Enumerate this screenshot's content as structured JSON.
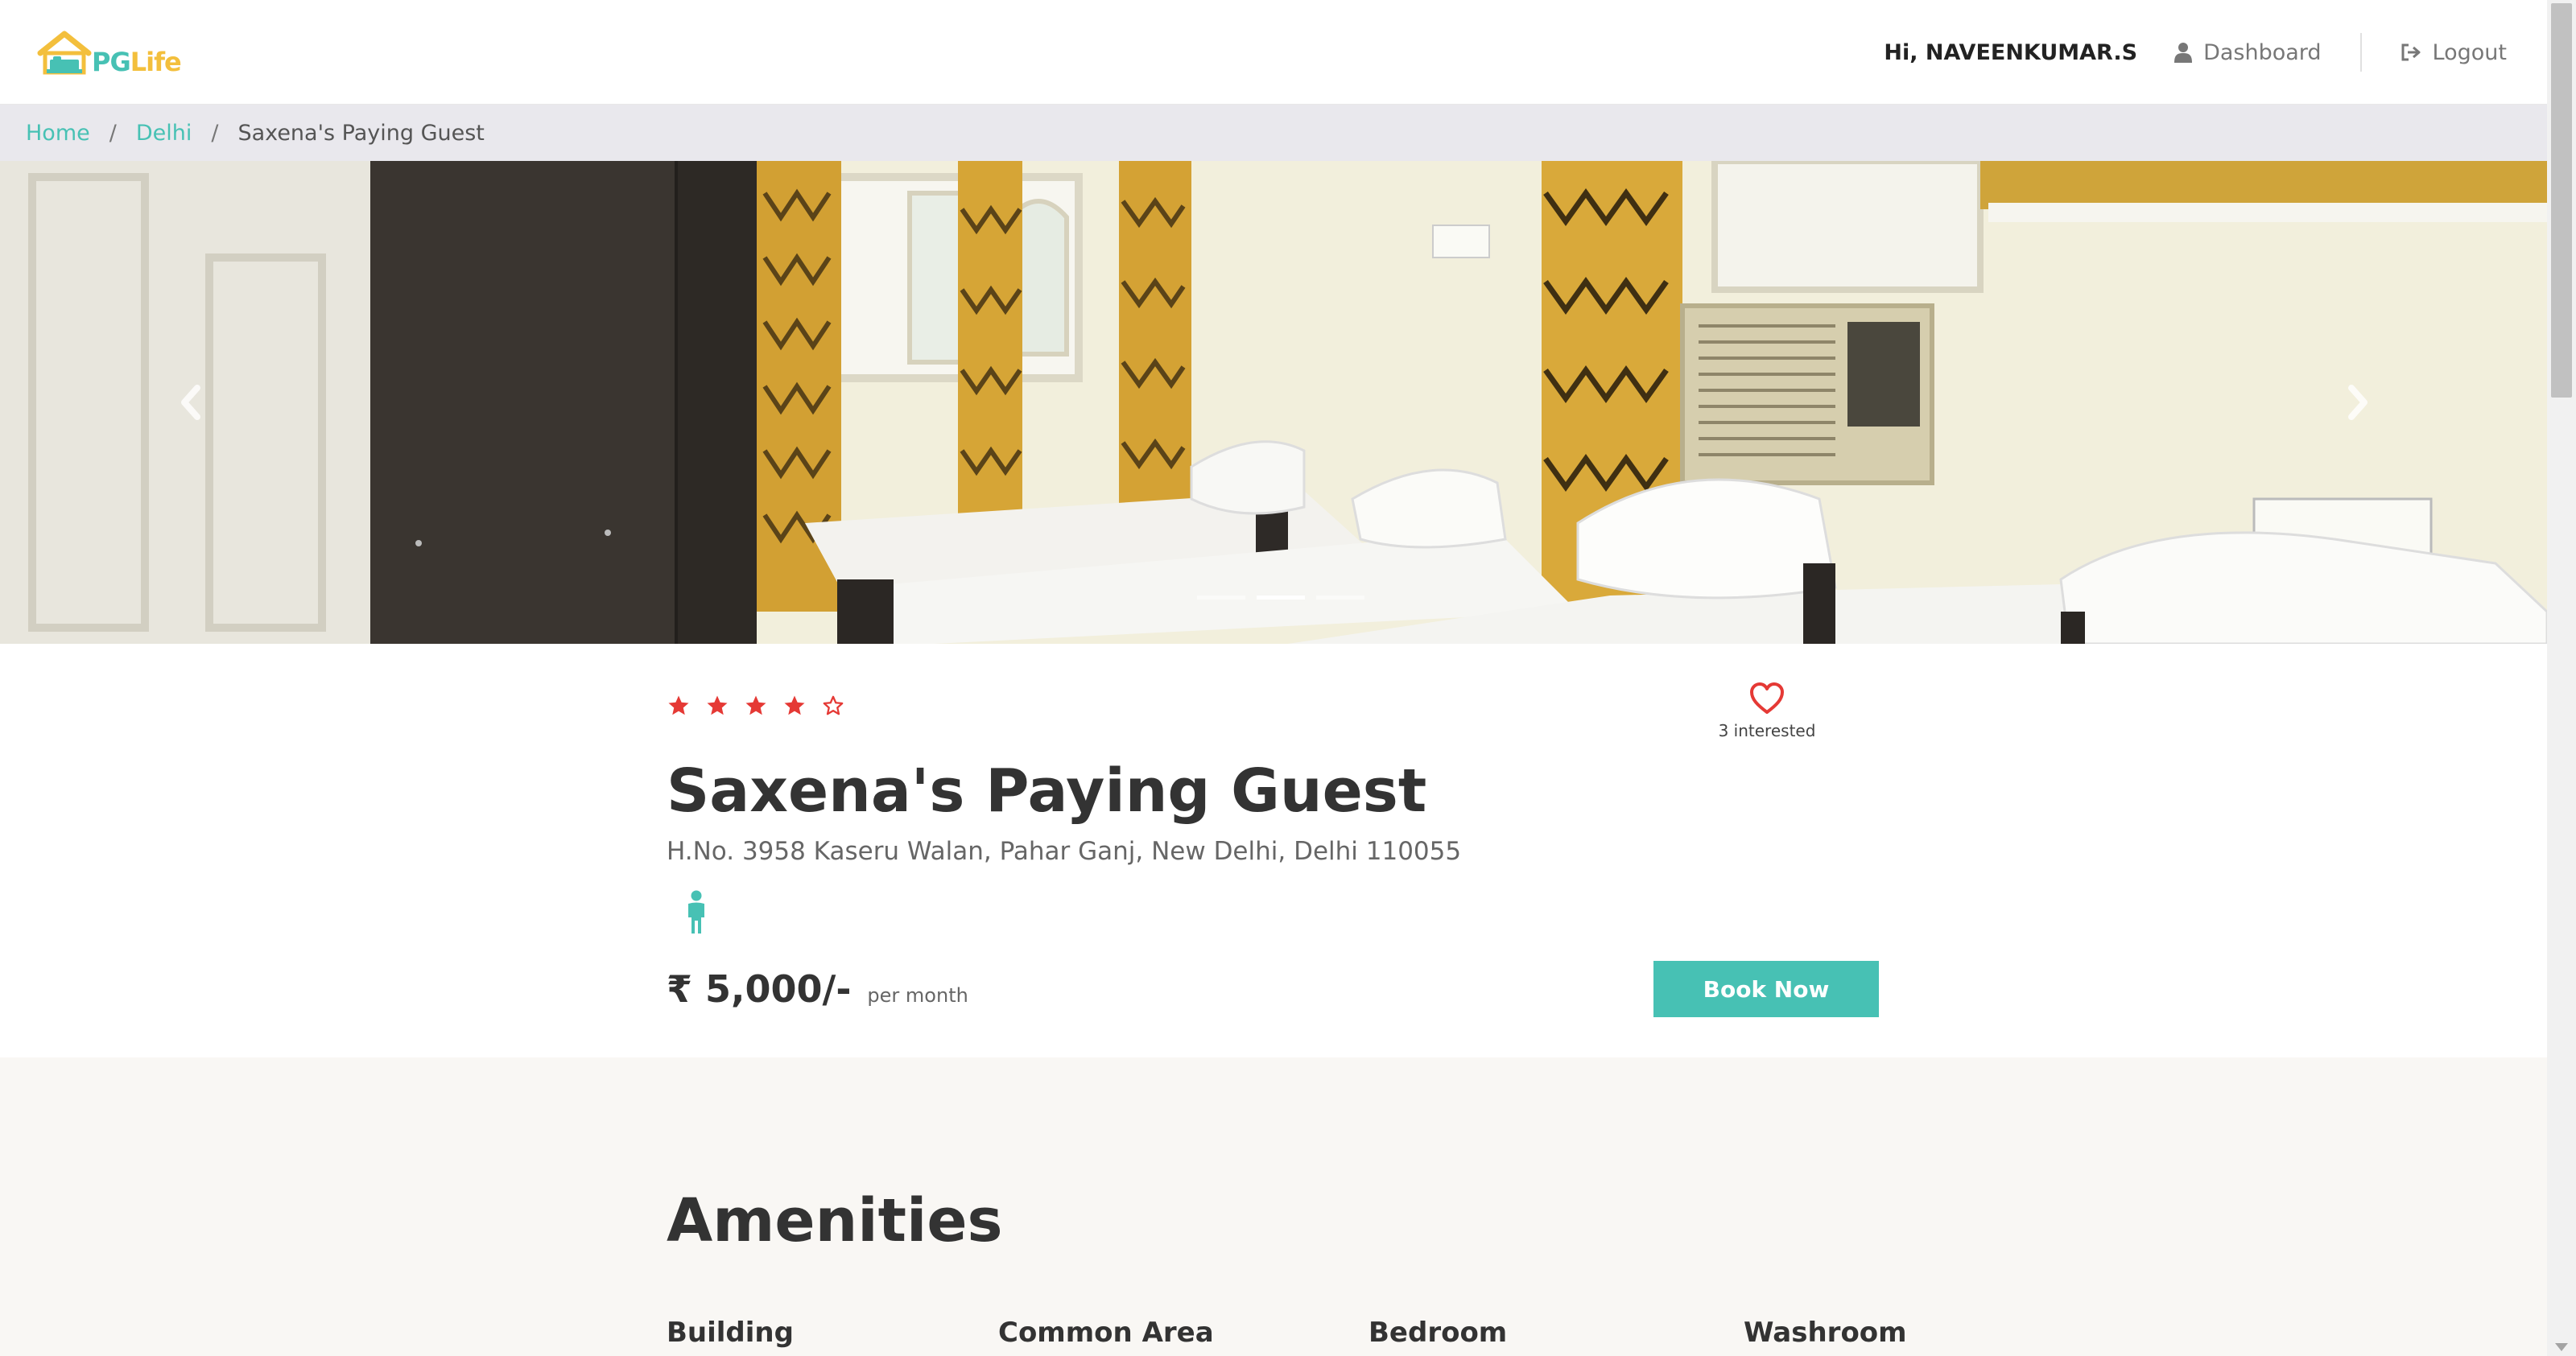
{
  "app": {
    "logo_pg": "PG",
    "logo_life": "Life"
  },
  "navbar": {
    "greeting": "Hi, NAVEENKUMAR.S",
    "dashboard_label": "Dashboard",
    "logout_label": "Logout"
  },
  "breadcrumb": {
    "home": "Home",
    "city": "Delhi",
    "current": "Saxena's Paying Guest",
    "separator": "/"
  },
  "carousel": {
    "slide_count": 3,
    "active_index": 1
  },
  "property": {
    "rating_stars": 4,
    "rating_max": 5,
    "interested_text": "3 interested",
    "name": "Saxena's Paying Guest",
    "address": "H.No. 3958 Kaseru Walan, Pahar Ganj, New Delhi, Delhi 110055",
    "gender_icon": "male-icon",
    "rent": "₹ 5,000/-",
    "rent_unit": "per month",
    "book_label": "Book Now"
  },
  "amenities": {
    "title": "Amenities",
    "columns": [
      "Building",
      "Common Area",
      "Bedroom",
      "Washroom"
    ]
  },
  "colors": {
    "brand_teal": "#47c1b4",
    "brand_yellow": "#f3bf3c",
    "star_red": "#e53935",
    "breadcrumb_bg": "#e9e8ed",
    "amenities_bg": "#f9f7f4"
  }
}
